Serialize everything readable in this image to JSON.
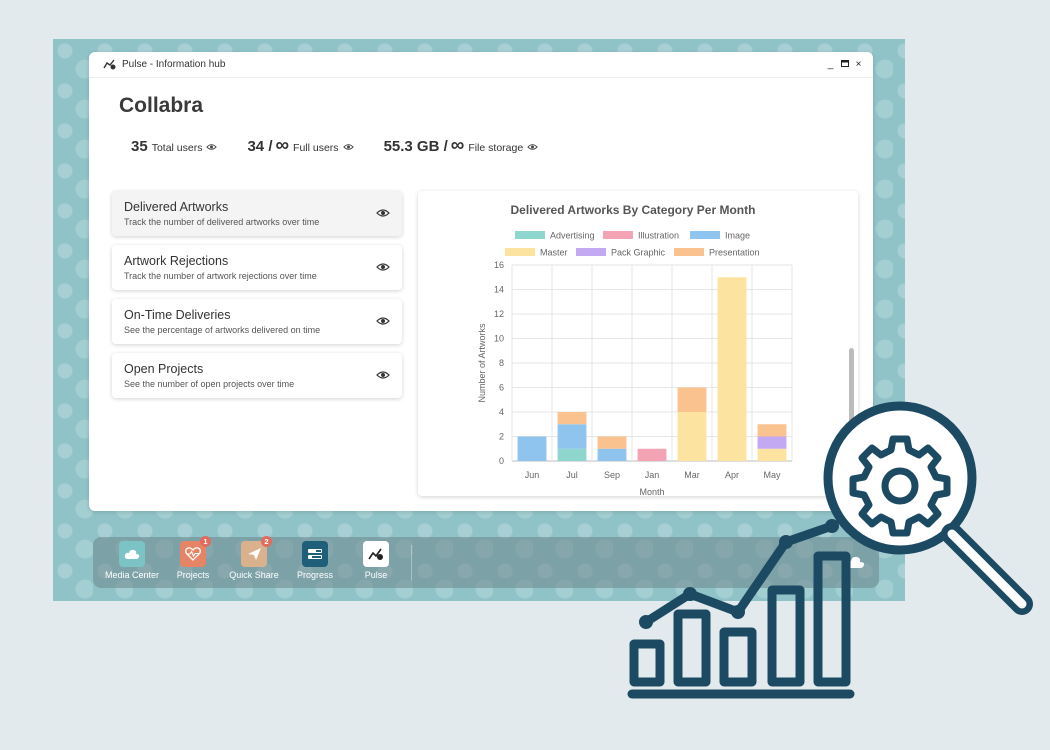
{
  "window": {
    "title": "Pulse - Information hub"
  },
  "org_name": "Collabra",
  "stats": [
    {
      "value": "35",
      "infinity": "",
      "label": "Total users"
    },
    {
      "value": "34 /",
      "infinity": "∞",
      "label": "Full users"
    },
    {
      "value": "55.3 GB /",
      "infinity": "∞",
      "label": "File storage"
    }
  ],
  "metrics": [
    {
      "title": "Delivered Artworks",
      "desc": "Track the number of delivered artworks over time",
      "active": true
    },
    {
      "title": "Artwork Rejections",
      "desc": "Track the number of artwork rejections over time",
      "active": false
    },
    {
      "title": "On-Time Deliveries",
      "desc": "See the percentage of artworks delivered on time",
      "active": false
    },
    {
      "title": "Open Projects",
      "desc": "See the number of open projects over time",
      "active": false
    }
  ],
  "chart_data": {
    "type": "bar",
    "stacked": true,
    "title": "Delivered Artworks By Category Per Month",
    "xlabel": "Month",
    "ylabel": "Number of Artworks",
    "ylim": [
      0,
      16
    ],
    "yticks": [
      0,
      2,
      4,
      6,
      8,
      10,
      12,
      14,
      16
    ],
    "grid": true,
    "legend_position": "top",
    "categories": [
      "Jun",
      "Jul",
      "Sep",
      "Jan",
      "Mar",
      "Apr",
      "May"
    ],
    "series": [
      {
        "name": "Advertising",
        "color": "#8fd6cf",
        "values": [
          0,
          1,
          0,
          0,
          0,
          0,
          0
        ]
      },
      {
        "name": "Illustration",
        "color": "#f4a3b4",
        "values": [
          0,
          0,
          0,
          1,
          0,
          0,
          0
        ]
      },
      {
        "name": "Image",
        "color": "#8ec4ee",
        "values": [
          2,
          2,
          1,
          0,
          0,
          0,
          0
        ]
      },
      {
        "name": "Master",
        "color": "#fde3a0",
        "values": [
          0,
          0,
          0,
          0,
          4,
          15,
          1
        ]
      },
      {
        "name": "Pack Graphic",
        "color": "#c3a8f2",
        "values": [
          0,
          0,
          0,
          0,
          0,
          0,
          1
        ]
      },
      {
        "name": "Presentation",
        "color": "#f9c28f",
        "values": [
          0,
          1,
          1,
          0,
          2,
          0,
          1
        ]
      }
    ]
  },
  "dock": [
    {
      "label": "Media Center",
      "icon": "cloud-icon",
      "color": "#7cc3c6",
      "badge": ""
    },
    {
      "label": "Projects",
      "icon": "heart-pulse-icon",
      "color": "#e58566",
      "badge": "1"
    },
    {
      "label": "Quick Share",
      "icon": "paper-plane-icon",
      "color": "#d9b28d",
      "badge": "2"
    },
    {
      "label": "Progress",
      "icon": "progress-bars-icon",
      "color": "#1f5f7a",
      "badge": ""
    },
    {
      "label": "Pulse",
      "icon": "pulse-chart-icon",
      "color": "#ffffff",
      "badge": ""
    }
  ]
}
